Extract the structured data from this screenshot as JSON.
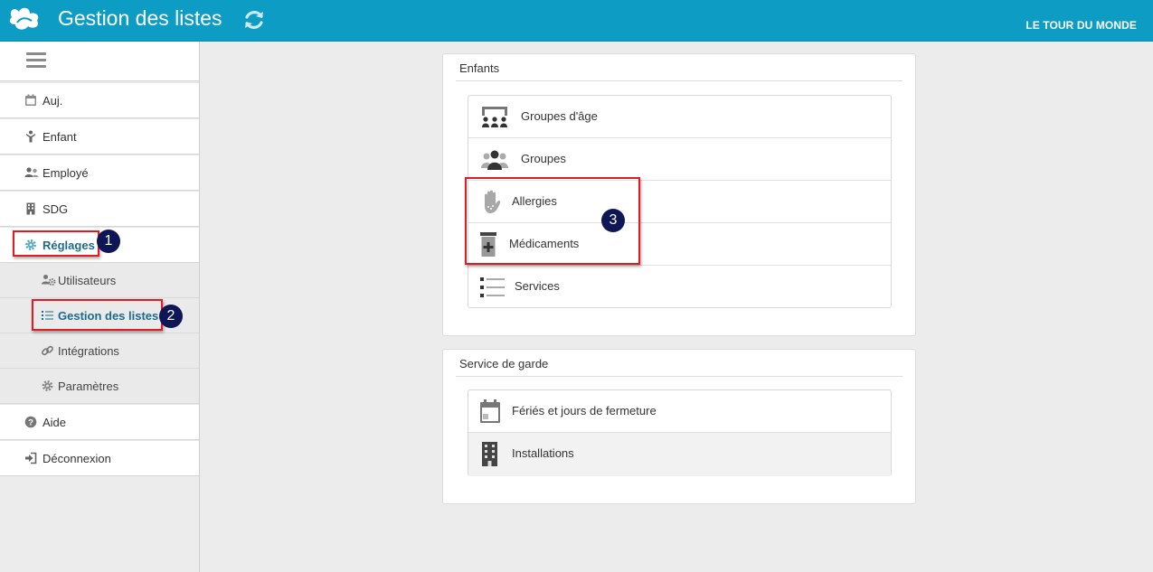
{
  "header": {
    "app_title": "Gestion des listes",
    "organization": "LE TOUR DU MONDE",
    "brand_color": "#0c9cc4"
  },
  "sidebar": {
    "items": [
      {
        "label": "Auj.",
        "icon": "calendar-icon"
      },
      {
        "label": "Enfant",
        "icon": "child-icon"
      },
      {
        "label": "Employé",
        "icon": "users-icon"
      },
      {
        "label": "SDG",
        "icon": "building-icon"
      },
      {
        "label": "Réglages",
        "icon": "gear-icon",
        "active": true
      },
      {
        "label": "Aide",
        "icon": "help-icon"
      },
      {
        "label": "Déconnexion",
        "icon": "logout-icon"
      }
    ],
    "sub_items": [
      {
        "label": "Utilisateurs",
        "icon": "users-gear-icon"
      },
      {
        "label": "Gestion des listes",
        "icon": "list-icon",
        "active": true
      },
      {
        "label": "Intégrations",
        "icon": "link-icon"
      },
      {
        "label": "Paramètres",
        "icon": "gear-icon"
      }
    ]
  },
  "markers": {
    "one": "1",
    "two": "2",
    "three": "3"
  },
  "panels": {
    "enfants": {
      "title": "Enfants",
      "items": [
        {
          "label": "Groupes d'âge",
          "icon": "age-groups-icon"
        },
        {
          "label": "Groupes",
          "icon": "groups-icon"
        },
        {
          "label": "Allergies",
          "icon": "allergy-hand-icon"
        },
        {
          "label": "Médicaments",
          "icon": "medicine-icon"
        },
        {
          "label": "Services",
          "icon": "list-icon"
        }
      ]
    },
    "service_de_garde": {
      "title": "Service de garde",
      "items": [
        {
          "label": "Fériés et jours de fermeture",
          "icon": "calendar-icon"
        },
        {
          "label": "Installations",
          "icon": "building-icon"
        }
      ]
    }
  },
  "colors": {
    "highlight_border": "#e01b24",
    "marker_bg": "#0e1656",
    "active_text": "#1d6a8a"
  }
}
